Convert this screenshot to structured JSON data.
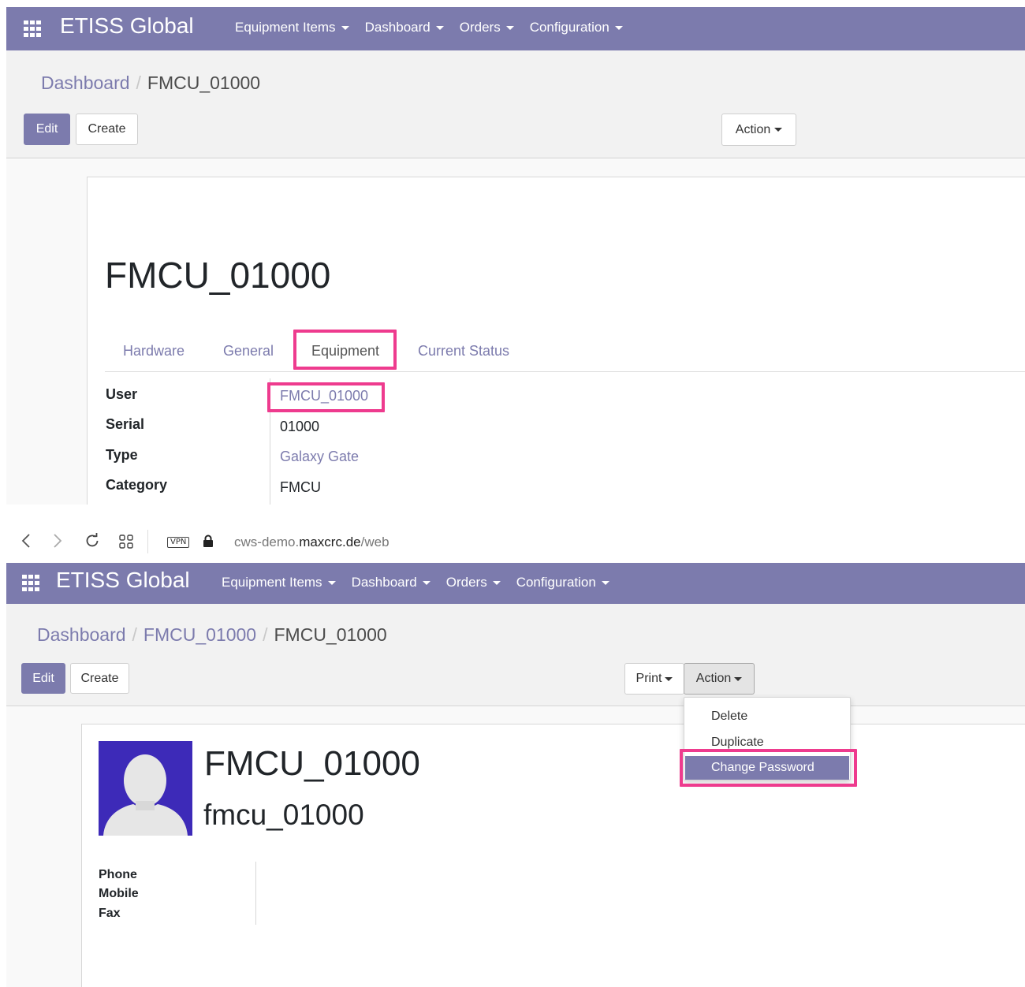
{
  "app": {
    "brand": "ETISS Global",
    "menu": [
      "Equipment Items",
      "Dashboard",
      "Orders",
      "Configuration"
    ]
  },
  "top": {
    "breadcrumb": {
      "link": "Dashboard",
      "current": "FMCU_01000"
    },
    "buttons": {
      "edit": "Edit",
      "create": "Create",
      "action": "Action"
    },
    "record_title": "FMCU_01000",
    "tabs": [
      "Hardware",
      "General",
      "Equipment",
      "Current Status"
    ],
    "active_tab": "Equipment",
    "fields": [
      {
        "label": "User",
        "value": "FMCU_01000"
      },
      {
        "label": "Serial",
        "value": "01000"
      },
      {
        "label": "Type",
        "value": "Galaxy Gate"
      },
      {
        "label": "Category",
        "value": "FMCU"
      }
    ]
  },
  "browser": {
    "url_prefix": "cws-demo.",
    "url_domain": "maxcrc.de",
    "url_path": "/web",
    "vpn_label": "VPN"
  },
  "bottom": {
    "breadcrumb": {
      "link1": "Dashboard",
      "link2": "FMCU_01000",
      "current": "FMCU_01000"
    },
    "buttons": {
      "edit": "Edit",
      "create": "Create",
      "print": "Print",
      "action": "Action"
    },
    "action_menu": [
      "Delete",
      "Duplicate",
      "Change Password"
    ],
    "highlighted_action": "Change Password",
    "record_name": "FMCU_01000",
    "login": "fmcu_01000",
    "contact_labels": [
      "Phone",
      "Mobile",
      "Fax"
    ]
  },
  "colors": {
    "brand": "#7c7bad",
    "highlight": "#ee3b8e",
    "avatar_bg": "#3d2ab8"
  }
}
